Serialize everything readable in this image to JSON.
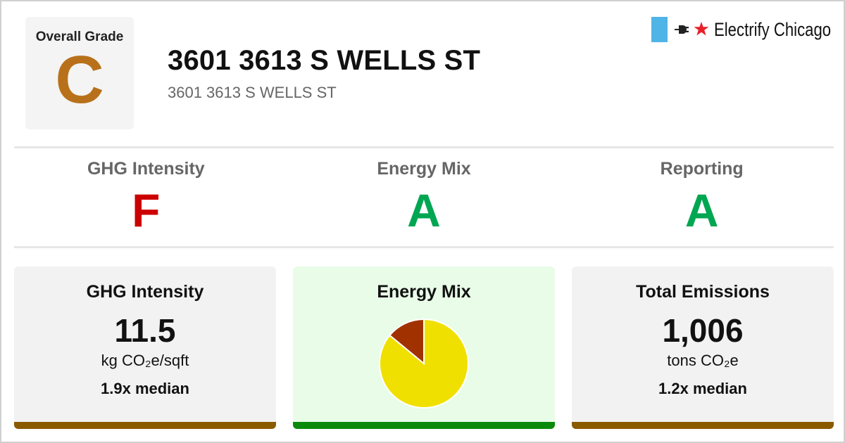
{
  "overall": {
    "label": "Overall Grade",
    "grade": "C",
    "grade_color": "#b8711a"
  },
  "building": {
    "title": "3601 3613 S WELLS ST",
    "address": "3601 3613 S WELLS ST"
  },
  "logo": {
    "text": "Electrify Chicago",
    "flag_color": "#4fb4e6",
    "star_color": "#e8202a",
    "icons": [
      "plug-icon",
      "star-icon"
    ]
  },
  "grades": [
    {
      "label": "GHG Intensity",
      "grade": "F",
      "color": "#cc0000"
    },
    {
      "label": "Energy Mix",
      "grade": "A",
      "color": "#00a651"
    },
    {
      "label": "Reporting",
      "grade": "A",
      "color": "#00a651"
    }
  ],
  "cards": {
    "ghg": {
      "title": "GHG Intensity",
      "value": "11.5",
      "unit": "kg CO₂e/sqft",
      "median": "1.9x median",
      "bar_color": "#8a5a00"
    },
    "mix": {
      "title": "Energy Mix",
      "bar_color": "#0a8a0a",
      "background": "#e8fce8"
    },
    "emissions": {
      "title": "Total Emissions",
      "value": "1,006",
      "unit": "tons CO₂e",
      "median": "1.2x median",
      "bar_color": "#8a5a00"
    }
  },
  "chart_data": {
    "type": "pie",
    "values": [
      86,
      14
    ],
    "colors": [
      "#f0e000",
      "#a13200"
    ]
  }
}
